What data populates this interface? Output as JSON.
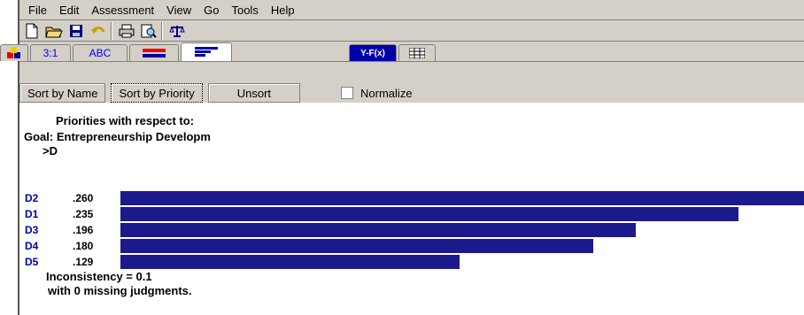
{
  "menu": [
    "File",
    "Edit",
    "Assessment",
    "View",
    "Go",
    "Tools",
    "Help"
  ],
  "toolbar_icons": [
    "new-icon",
    "open-folder-icon",
    "save-icon",
    "undo-icon",
    "print-icon",
    "print-preview-icon",
    "balance-icon"
  ],
  "tabs": [
    {
      "label": "",
      "icon": "cubes-icon"
    },
    {
      "label": "3:1"
    },
    {
      "label": "ABC"
    },
    {
      "label": "",
      "icon": "lines-icon"
    },
    {
      "label": "",
      "icon": "bar-lines-icon"
    },
    {
      "label": "Y-F(x)"
    },
    {
      "label": "",
      "icon": "grid-icon"
    }
  ],
  "buttons": {
    "sort_name": "Sort by Name",
    "sort_priority": "Sort by Priority",
    "unsort": "Unsort",
    "normalize": "Normalize"
  },
  "content": {
    "line1": "Priorities with respect to:",
    "line2": "Goal: Entrepreneurship Developm",
    "line3": ">D",
    "rows": [
      {
        "label": "D2",
        "value": ".260"
      },
      {
        "label": "D1",
        "value": ".235"
      },
      {
        "label": "D3",
        "value": ".196"
      },
      {
        "label": "D4",
        "value": ".180"
      },
      {
        "label": "D5",
        "value": ".129"
      }
    ],
    "inconsistency": "Inconsistency = 0.1",
    "missing": "with 0  missing judgments."
  },
  "chart_data": {
    "type": "bar",
    "categories": [
      "D2",
      "D1",
      "D3",
      "D4",
      "D5"
    ],
    "values": [
      0.26,
      0.235,
      0.196,
      0.18,
      0.129
    ],
    "xlim": [
      0,
      0.26
    ]
  },
  "colors": {
    "bar": "#1a1a8c",
    "label": "#0000aa",
    "chrome": "#d4d0c8"
  }
}
